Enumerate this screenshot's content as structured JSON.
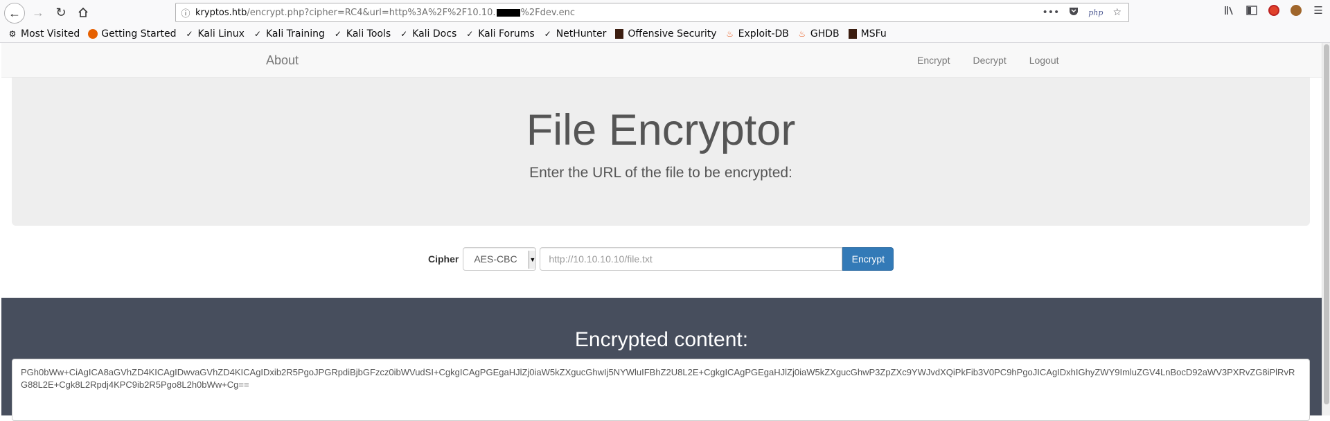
{
  "browser": {
    "url_host": "kryptos.htb",
    "url_path_before": "/encrypt.php?cipher=RC4&url=http%3A%2F%2F10.10.",
    "url_path_after": "%2Fdev.enc",
    "php_badge": "php"
  },
  "bookmarks": [
    {
      "label": "Most Visited",
      "icon": "gear-icon"
    },
    {
      "label": "Getting Started",
      "icon": "firefox-icon"
    },
    {
      "label": "Kali Linux",
      "icon": "kali-icon"
    },
    {
      "label": "Kali Training",
      "icon": "kali-icon"
    },
    {
      "label": "Kali Tools",
      "icon": "kali-icon"
    },
    {
      "label": "Kali Docs",
      "icon": "kali-icon"
    },
    {
      "label": "Kali Forums",
      "icon": "kali-icon"
    },
    {
      "label": "NetHunter",
      "icon": "kali-icon"
    },
    {
      "label": "Offensive Security",
      "icon": "offsec-icon"
    },
    {
      "label": "Exploit-DB",
      "icon": "exploitdb-icon"
    },
    {
      "label": "GHDB",
      "icon": "exploitdb-icon"
    },
    {
      "label": "MSFu",
      "icon": "offsec-icon"
    }
  ],
  "nav": {
    "brand": "About",
    "links": [
      "Encrypt",
      "Decrypt",
      "Logout"
    ]
  },
  "hero": {
    "title": "File Encryptor",
    "subtitle": "Enter the URL of the file to be encrypted:"
  },
  "form": {
    "cipher_label": "Cipher",
    "cipher_value": "AES-CBC",
    "url_placeholder": "http://10.10.10.10/file.txt",
    "submit_label": "Encrypt"
  },
  "result": {
    "heading": "Encrypted content:",
    "content": "PGh0bWw+CiAgICA8aGVhZD4KICAgIDwvaGVhZD4KICAgIDxib2R5PgoJPGRpdiBjbGFzcz0ibWVudSI+CgkgICAgPGEgaHJlZj0iaW5kZXgucGhwIj5NYWluIFBhZ2U8L2E+CgkgICAgPGEgaHJlZj0iaW5kZXgucGhwP3ZpZXc9YWJvdXQiPkFib3V0PC9hPgoJICAgIDxhIGhyZWY9ImluZGV4LnBocD92aWV3PXRvZG8iPlRvRG88L2E+Cgk8L2Rpdj4KPC9ib2R5Pgo8L2h0bWw+Cg=="
  },
  "colors": {
    "primary_button": "#337ab7",
    "dark_section": "#474e5d",
    "jumbotron": "#eeeeee"
  }
}
